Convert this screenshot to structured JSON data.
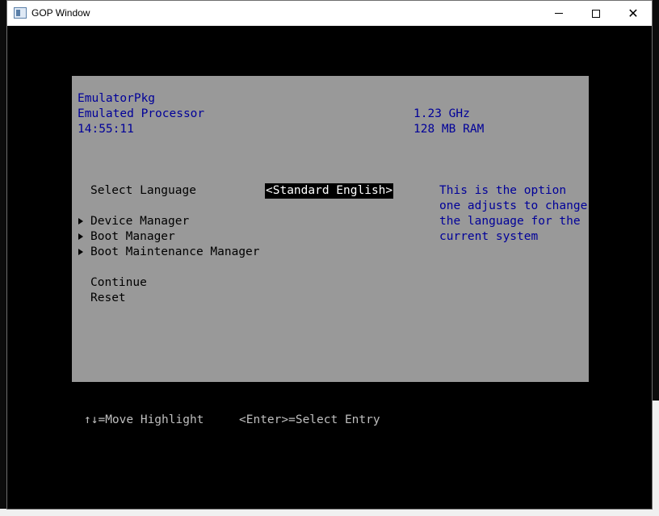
{
  "window": {
    "title": "GOP Window"
  },
  "header": {
    "platform": "EmulatorPkg",
    "processor": "Emulated Processor",
    "time": "14:55:11",
    "speed": "1.23 GHz",
    "memory": "128 MB RAM"
  },
  "menu": {
    "select_language_label": "Select Language",
    "language_value": "<Standard English>",
    "items": [
      {
        "label": "Device Manager"
      },
      {
        "label": "Boot Manager"
      },
      {
        "label": "Boot Maintenance Manager"
      }
    ],
    "continue_label": "Continue",
    "reset_label": "Reset"
  },
  "help": {
    "lines": [
      "This is the option",
      "one adjusts to change",
      "the language for the",
      "current system"
    ]
  },
  "footer": {
    "move_hint": "↑↓=Move Highlight",
    "enter_hint": "<Enter>=Select Entry"
  },
  "colors": {
    "panel_bg": "#999999",
    "text_blue": "#000099",
    "highlight_bg": "#000000",
    "footer_text": "#bfbfbf"
  }
}
